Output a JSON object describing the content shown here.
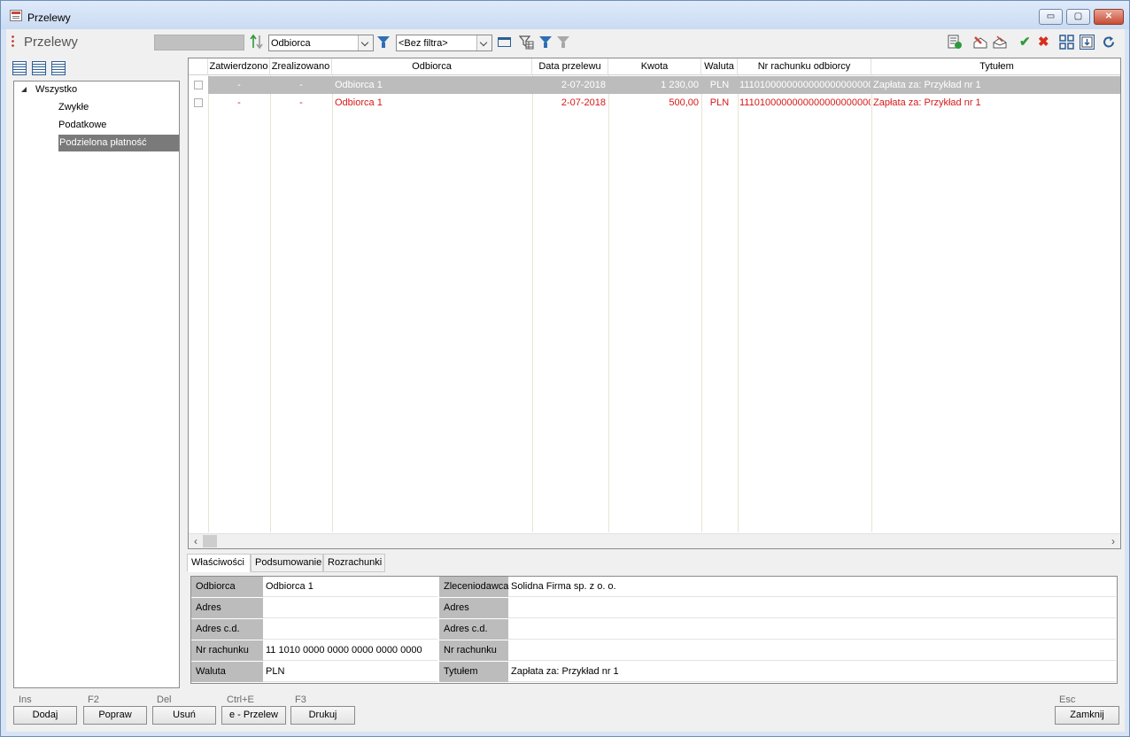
{
  "window": {
    "title": "Przelewy",
    "minimize_glyph": "▭",
    "maximize_glyph": "▢",
    "close_glyph": "✕"
  },
  "toolbar": {
    "page_title": "Przelewy",
    "sort_field": "Odbiorca",
    "filter_value": "<Bez filtra>"
  },
  "tree": {
    "items": [
      {
        "label": "Wszystko"
      },
      {
        "label": "Zwykłe"
      },
      {
        "label": "Podatkowe"
      },
      {
        "label": "Podzielona płatność"
      }
    ]
  },
  "grid": {
    "columns": [
      "Zatwierdzono",
      "Zrealizowano",
      "Odbiorca",
      "Data przelewu",
      "Kwota",
      "Waluta",
      "Nr rachunku odbiorcy",
      "Tytułem"
    ],
    "rows": [
      {
        "zatwierdzono": "-",
        "zrealizowano": "-",
        "odbiorca": "Odbiorca 1",
        "data": "2-07-2018",
        "kwota": "1 230,00",
        "waluta": "PLN",
        "rachunek": "11101000000000000000000000",
        "tytulem": "Zapłata za: Przykład nr 1"
      },
      {
        "zatwierdzono": "-",
        "zrealizowano": "-",
        "odbiorca": "Odbiorca 1",
        "data": "2-07-2018",
        "kwota": "500,00",
        "waluta": "PLN",
        "rachunek": "11101000000000000000000000",
        "tytulem": "Zapłata za: Przykład nr 1"
      }
    ]
  },
  "tabs": [
    "Właściwości",
    "Podsumowanie",
    "Rozrachunki"
  ],
  "properties": {
    "left": [
      {
        "label": "Odbiorca",
        "value": "Odbiorca 1"
      },
      {
        "label": "Adres",
        "value": ""
      },
      {
        "label": "Adres c.d.",
        "value": ""
      },
      {
        "label": "Nr rachunku",
        "value": "11 1010 0000 0000 0000 0000 0000"
      },
      {
        "label": "Waluta",
        "value": "PLN"
      }
    ],
    "right": [
      {
        "label": "Zleceniodawca",
        "value": "Solidna Firma sp. z o. o."
      },
      {
        "label": "Adres",
        "value": ""
      },
      {
        "label": "Adres c.d.",
        "value": ""
      },
      {
        "label": "Nr rachunku",
        "value": ""
      },
      {
        "label": "Tytułem",
        "value": "Zapłata za: Przykład nr 1"
      }
    ]
  },
  "buttons": [
    {
      "shortcut": "Ins",
      "label": "Dodaj"
    },
    {
      "shortcut": "F2",
      "label": "Popraw"
    },
    {
      "shortcut": "Del",
      "label": "Usuń"
    },
    {
      "shortcut": "Ctrl+E",
      "label": "e - Przelew"
    },
    {
      "shortcut": "F3",
      "label": "Drukuj"
    },
    {
      "shortcut": "Esc",
      "label": "Zamknij"
    }
  ],
  "icons": {
    "scroll_left": "‹",
    "scroll_right": "›",
    "approve": "✔",
    "reject": "✖"
  },
  "colors": {
    "selected_row": "#bcbcbc",
    "red_row_text": "#d71818",
    "tree_selected": "#7a7a7a",
    "prop_label_bg": "#bcbcbc"
  }
}
